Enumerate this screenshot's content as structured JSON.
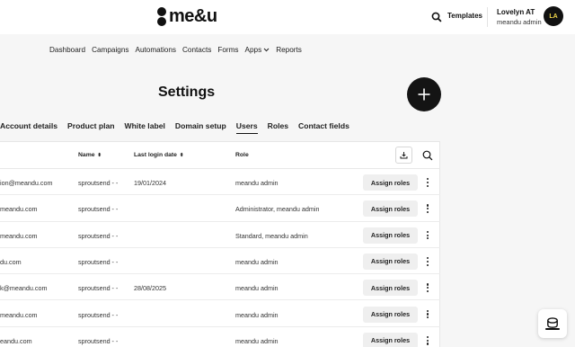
{
  "header": {
    "logo_text": "me&u",
    "templates_label": "Templates",
    "user_name": "Lovelyn AT",
    "user_role": "meandu admin",
    "avatar_initials": "LA"
  },
  "nav": {
    "items": [
      {
        "label": "Dashboard"
      },
      {
        "label": "Campaigns"
      },
      {
        "label": "Automations"
      },
      {
        "label": "Contacts"
      },
      {
        "label": "Forms"
      },
      {
        "label": "Apps"
      },
      {
        "label": "Reports"
      }
    ]
  },
  "page_title": "Settings",
  "tabs": [
    {
      "label": "Account details"
    },
    {
      "label": "Product plan"
    },
    {
      "label": "White label"
    },
    {
      "label": "Domain setup"
    },
    {
      "label": "Users",
      "active": true
    },
    {
      "label": "Roles"
    },
    {
      "label": "Contact fields"
    }
  ],
  "table": {
    "headers": {
      "name": "Name",
      "last_login": "Last login date",
      "role": "Role"
    },
    "assign_label": "Assign roles",
    "rows": [
      {
        "email": "ion@meandu.com",
        "name": "sproutsend - -",
        "last_login": "19/01/2024",
        "role": "meandu admin"
      },
      {
        "email": "meandu.com",
        "name": "sproutsend - -",
        "last_login": "",
        "role": "Administrator, meandu admin"
      },
      {
        "email": "meandu.com",
        "name": "sproutsend - -",
        "last_login": "",
        "role": "Standard, meandu admin"
      },
      {
        "email": "du.com",
        "name": "sproutsend - -",
        "last_login": "",
        "role": "meandu admin"
      },
      {
        "email": "k@meandu.com",
        "name": "sproutsend - -",
        "last_login": "28/08/2025",
        "role": "meandu admin"
      },
      {
        "email": "meandu.com",
        "name": "sproutsend - -",
        "last_login": "",
        "role": "meandu admin"
      },
      {
        "email": "eandu.com",
        "name": "sproutsend - -",
        "last_login": "",
        "role": "meandu admin"
      }
    ]
  },
  "colors": {
    "brand_dark": "#111111",
    "avatar_text": "#f1d64a",
    "page_bg": "#f6f6f6"
  }
}
